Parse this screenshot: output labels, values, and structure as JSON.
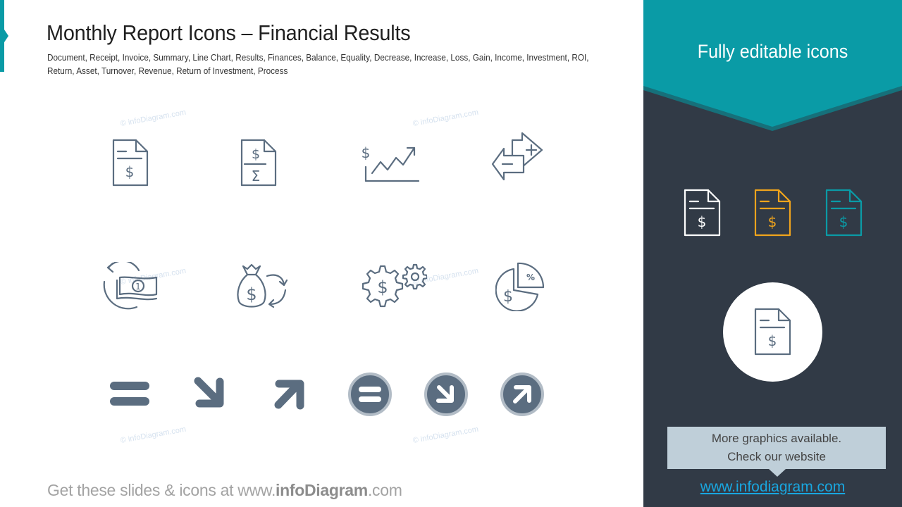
{
  "header": {
    "title": "Monthly Report Icons – Financial Results",
    "subtitle": "Document, Receipt, Invoice, Summary, Line Chart, Results, Finances, Balance, Equality, Decrease, Increase, Loss, Gain, Income, Investment, ROI, Return, Asset, Turnover, Revenue, Return of Investment, Process"
  },
  "watermark_text": "© infoDiagram.com",
  "icons": {
    "row1": [
      "document-dollar-icon",
      "invoice-summary-icon",
      "line-chart-dollar-icon",
      "balance-arrows-icon"
    ],
    "row2": [
      "money-turnover-icon",
      "money-bag-return-icon",
      "process-gears-dollar-icon",
      "roi-pie-icon"
    ],
    "row3": [
      "equality-icon",
      "decrease-arrow-icon",
      "increase-arrow-icon",
      "equality-circle-icon",
      "decrease-circle-icon",
      "increase-circle-icon"
    ],
    "glyphs": {
      "dollar": "$",
      "sigma": "Σ",
      "percent": "%",
      "one": "1",
      "plus": "+",
      "minus": "−"
    }
  },
  "footer": {
    "prefix": "Get these slides & icons at www.",
    "brand": "infoDiagram",
    "suffix": ".com"
  },
  "right_panel": {
    "banner_text": "Fully editable icons",
    "color_variants": [
      {
        "name": "white",
        "color": "#ffffff"
      },
      {
        "name": "orange",
        "color": "#f0a41c"
      },
      {
        "name": "teal",
        "color": "#0a9ba6"
      }
    ],
    "callout_line1": "More graphics available.",
    "callout_line2": "Check our website",
    "website": "www.infodiagram.com"
  },
  "colors": {
    "accent_teal": "#0a9ba6",
    "icon_slate": "#5b6d80",
    "icon_ring": "#b2bcc6",
    "panel_dark": "#313a46",
    "callout_bg": "#bfcfd9",
    "link_blue": "#19a7e0"
  }
}
